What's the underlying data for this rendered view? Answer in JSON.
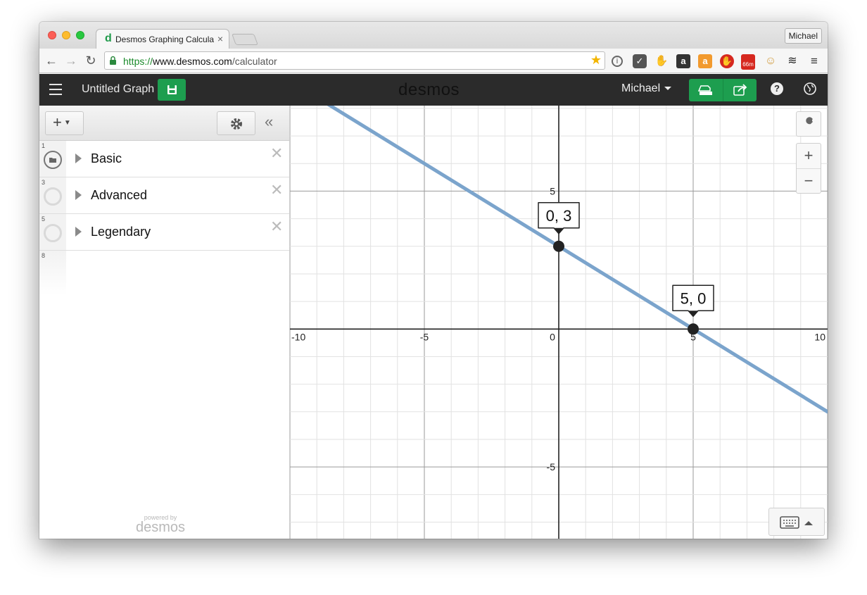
{
  "browser": {
    "tab_title": "Desmos Graphing Calculat",
    "tab_favicon": "d",
    "tab_close": "×",
    "profile_name": "Michael",
    "url_scheme": "https://",
    "url_host": "www.desmos.com",
    "url_path": "/calculator",
    "nav": {
      "back": "←",
      "forward": "→",
      "reload": "↻"
    },
    "extensions": [
      "info-icon",
      "pocket-icon",
      "evernote-icon",
      "amazon-icon",
      "amazon-orange-icon",
      "adblock-icon",
      "timer-badge-icon",
      "honey-icon",
      "buffer-icon",
      "menu-icon"
    ],
    "timer_badge_text": "66m"
  },
  "header": {
    "graph_title": "Untitled Graph",
    "logo": "desmos",
    "user_name": "Michael",
    "help_label": "?"
  },
  "sidebar": {
    "add_label": "+",
    "collapse_label": "«",
    "items": [
      {
        "num": "1",
        "label": "Basic",
        "type": "folder"
      },
      {
        "num": "3",
        "label": "Advanced",
        "type": "expression"
      },
      {
        "num": "5",
        "label": "Legendary",
        "type": "expression"
      }
    ],
    "empty_row_num": "8",
    "powered_by": "powered by",
    "powered_logo": "desmos"
  },
  "graph_controls": {
    "zoom_in": "+",
    "zoom_out": "−"
  },
  "chart_data": {
    "type": "line",
    "xlim": [
      -10,
      10
    ],
    "ylim": [
      -7.6,
      8.1
    ],
    "x_ticks": [
      -10,
      -5,
      0,
      5,
      10
    ],
    "y_ticks": [
      5,
      -5
    ],
    "x_tick_labels": [
      "-10",
      "-5",
      "0",
      "5",
      "10"
    ],
    "y_tick_labels": [
      "5",
      "-5"
    ],
    "grid": true,
    "line": {
      "slope": -0.6,
      "intercept": 3,
      "color": "#7ba4cc"
    },
    "points": [
      {
        "x": 0,
        "y": 3,
        "label": "0, 3"
      },
      {
        "x": 5,
        "y": 0,
        "label": "5, 0"
      }
    ]
  }
}
